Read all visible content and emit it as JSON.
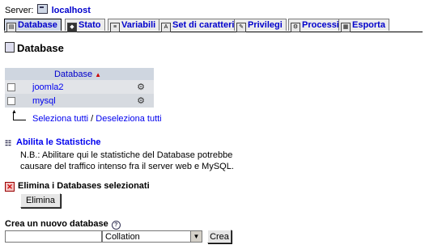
{
  "server": {
    "label": "Server:",
    "name": "localhost"
  },
  "tabs": [
    {
      "label": "Database",
      "icon": "database-icon",
      "active": true
    },
    {
      "label": "Stato",
      "icon": "status-icon"
    },
    {
      "label": "Variabili",
      "icon": "variables-icon"
    },
    {
      "label": "Set di caratteri",
      "icon": "charset-icon"
    },
    {
      "label": "Privilegi",
      "icon": "privileges-icon"
    },
    {
      "label": "Processi",
      "icon": "processes-icon"
    },
    {
      "label": "Esporta",
      "icon": "export-icon"
    }
  ],
  "heading": "Database",
  "table": {
    "column_header": "Database",
    "rows": [
      {
        "name": "joomla2"
      },
      {
        "name": "mysql"
      }
    ]
  },
  "selection": {
    "select_all": "Seleziona tutti",
    "separator": "/",
    "deselect_all": "Deseleziona tutti"
  },
  "stats": {
    "title": "Abilita le Statistiche",
    "note": "N.B.: Abilitare qui le statistiche del Database potrebbe causare del traffico intenso fra il server web e MySQL."
  },
  "drop": {
    "title": "Elimina i Databases selezionati",
    "button": "Elimina"
  },
  "create": {
    "title": "Crea un nuovo database",
    "name_value": "",
    "collation_selected": "Collation",
    "button": "Crea"
  },
  "colors": {
    "link": "#0000ee",
    "tab_active_bg": "#d0d8e8",
    "table_header_bg": "#cfd6e0"
  }
}
